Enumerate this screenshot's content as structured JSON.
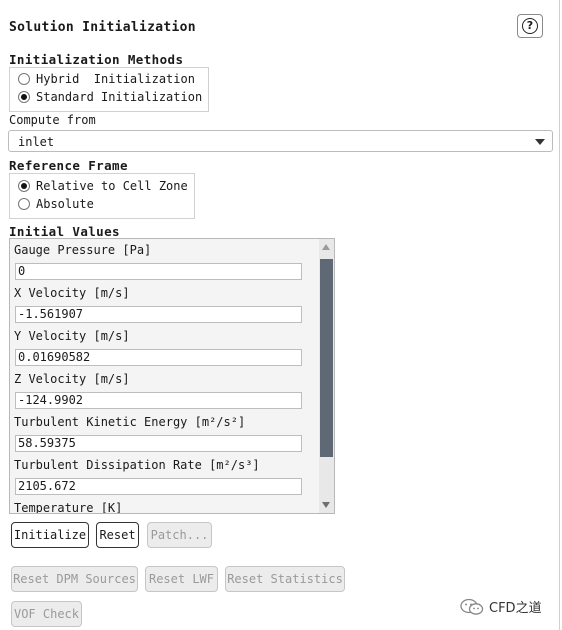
{
  "panel": {
    "title": "Solution Initialization",
    "help_icon": "question-icon",
    "help_glyph": "?"
  },
  "methods": {
    "label": "Initialization Methods",
    "options": [
      "Hybrid  Initialization",
      "Standard Initialization"
    ],
    "selected": 1
  },
  "compute_from": {
    "label": "Compute from",
    "value": "inlet"
  },
  "reference_frame": {
    "label": "Reference Frame",
    "options": [
      "Relative to Cell Zone",
      "Absolute"
    ],
    "selected": 0
  },
  "initial_values": {
    "label": "Initial Values",
    "fields": [
      {
        "label": "Gauge Pressure [Pa]",
        "value": "0"
      },
      {
        "label": "X Velocity [m/s]",
        "value": "-1.561907"
      },
      {
        "label": "Y Velocity [m/s]",
        "value": "0.01690582"
      },
      {
        "label": "Z Velocity [m/s]",
        "value": "-124.9902"
      },
      {
        "label": "Turbulent Kinetic Energy [m²/s²]",
        "value": "58.59375"
      },
      {
        "label": "Turbulent Dissipation Rate [m²/s³]",
        "value": "2105.672"
      },
      {
        "label": "Temperature [K]",
        "value": ""
      }
    ]
  },
  "buttons": {
    "initialize": "Initialize",
    "reset": "Reset",
    "patch": "Patch...",
    "reset_dpm": "Reset DPM Sources",
    "reset_lwf": "Reset LWF",
    "reset_statistics": "Reset Statistics",
    "vof_check": "VOF Check"
  },
  "watermark": {
    "text": "CFD之道"
  }
}
